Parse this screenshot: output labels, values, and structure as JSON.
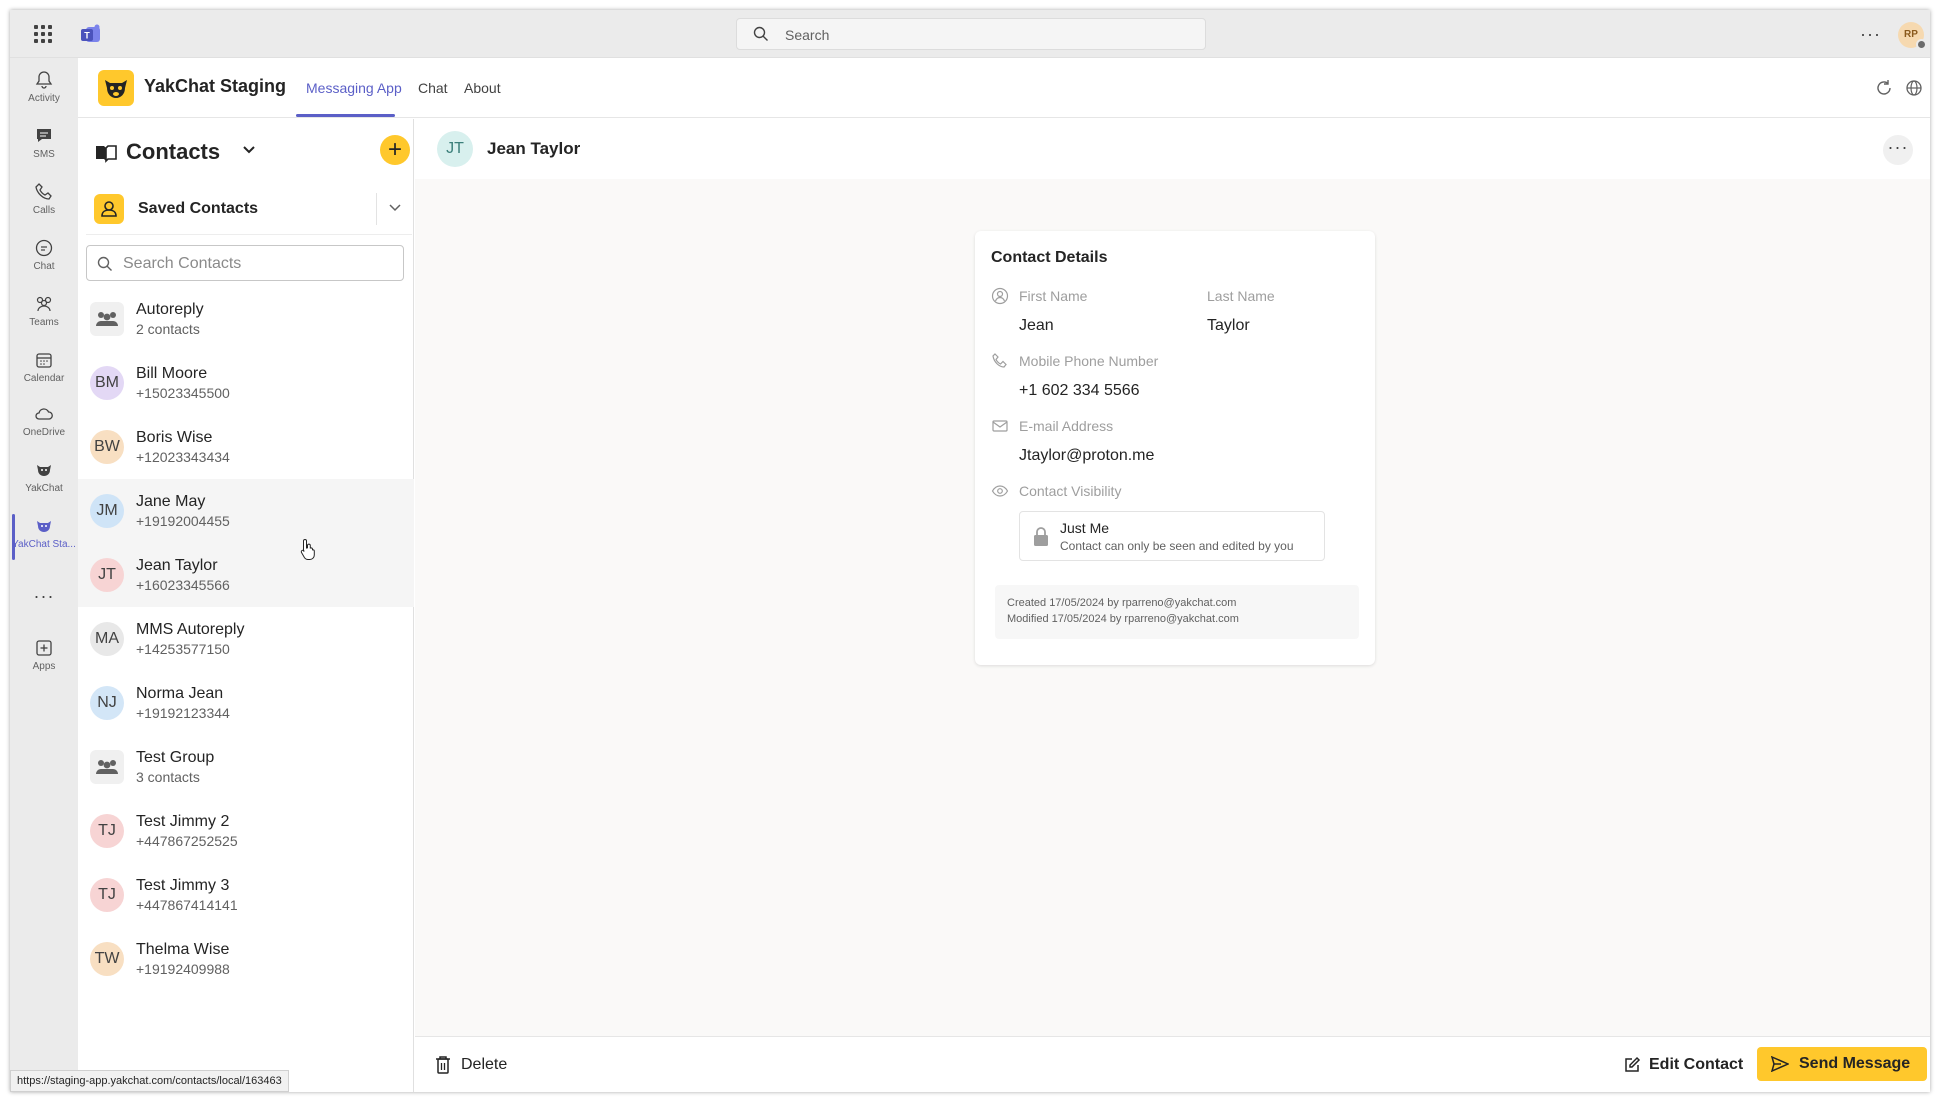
{
  "topbar": {
    "search_placeholder": "Search",
    "more": "···",
    "avatar_initials": "RP"
  },
  "rail": {
    "items": [
      {
        "label": "Activity",
        "icon": "bell-icon"
      },
      {
        "label": "SMS",
        "icon": "sms-icon"
      },
      {
        "label": "Calls",
        "icon": "phone-icon"
      },
      {
        "label": "Chat",
        "icon": "chat-icon"
      },
      {
        "label": "Teams",
        "icon": "teams-icon"
      },
      {
        "label": "Calendar",
        "icon": "calendar-icon"
      },
      {
        "label": "OneDrive",
        "icon": "cloud-icon"
      },
      {
        "label": "YakChat",
        "icon": "yakchat-icon"
      },
      {
        "label": "YakChat Sta...",
        "icon": "yakchat-staging-icon"
      },
      {
        "label": "Apps",
        "icon": "plus-box-icon"
      }
    ],
    "more": "···"
  },
  "app": {
    "title": "YakChat Staging",
    "tabs": [
      {
        "label": "Messaging App",
        "active": true
      },
      {
        "label": "Chat",
        "active": false
      },
      {
        "label": "About",
        "active": false
      }
    ]
  },
  "contacts": {
    "title": "Contacts",
    "selector": "Saved Contacts",
    "search_placeholder": "Search Contacts",
    "list": [
      {
        "initials": "",
        "name": "Autoreply",
        "sub": "2 contacts",
        "group": true,
        "color": "#f0f0f0"
      },
      {
        "initials": "BM",
        "name": "Bill Moore",
        "sub": "+15023345500",
        "group": false,
        "color": "#e3d8f5"
      },
      {
        "initials": "BW",
        "name": "Boris Wise",
        "sub": "+12023343434",
        "group": false,
        "color": "#f8dfc2"
      },
      {
        "initials": "JM",
        "name": "Jane May",
        "sub": "+19192004455",
        "group": false,
        "color": "#cfe4f7"
      },
      {
        "initials": "JT",
        "name": "Jean Taylor",
        "sub": "+16023345566",
        "group": false,
        "color": "#f7d4d4"
      },
      {
        "initials": "MA",
        "name": "MMS Autoreply",
        "sub": "+14253577150",
        "group": false,
        "color": "#e8e8e8"
      },
      {
        "initials": "NJ",
        "name": "Norma Jean",
        "sub": "+19192123344",
        "group": false,
        "color": "#d3e6f7"
      },
      {
        "initials": "",
        "name": "Test Group",
        "sub": "3 contacts",
        "group": true,
        "color": "#f0f0f0"
      },
      {
        "initials": "TJ",
        "name": "Test Jimmy 2",
        "sub": "+447867252525",
        "group": false,
        "color": "#f7d4d4"
      },
      {
        "initials": "TJ",
        "name": "Test Jimmy 3",
        "sub": "+447867414141",
        "group": false,
        "color": "#f7d4d4"
      },
      {
        "initials": "TW",
        "name": "Thelma Wise",
        "sub": "+19192409988",
        "group": false,
        "color": "#f8dfc2"
      }
    ]
  },
  "detail": {
    "initials": "JT",
    "name": "Jean Taylor",
    "more": "···",
    "card": {
      "title": "Contact Details",
      "first_name_label": "First Name",
      "first_name": "Jean",
      "last_name_label": "Last Name",
      "last_name": "Taylor",
      "phone_label": "Mobile Phone Number",
      "phone": "+1 602 334 5566",
      "email_label": "E-mail Address",
      "email": "Jtaylor@proton.me",
      "visibility_label": "Contact Visibility",
      "visibility_title": "Just Me",
      "visibility_desc": "Contact can only be seen and edited by you",
      "created": "Created 17/05/2024 by rparreno@yakchat.com",
      "modified": "Modified 17/05/2024 by rparreno@yakchat.com"
    },
    "footer": {
      "delete": "Delete",
      "edit": "Edit Contact",
      "send": "Send Message"
    }
  },
  "status_url": "https://staging-app.yakchat.com/contacts/local/163463",
  "colors": {
    "accent": "#5b5fc7",
    "brand_yellow": "#ffc82c"
  }
}
